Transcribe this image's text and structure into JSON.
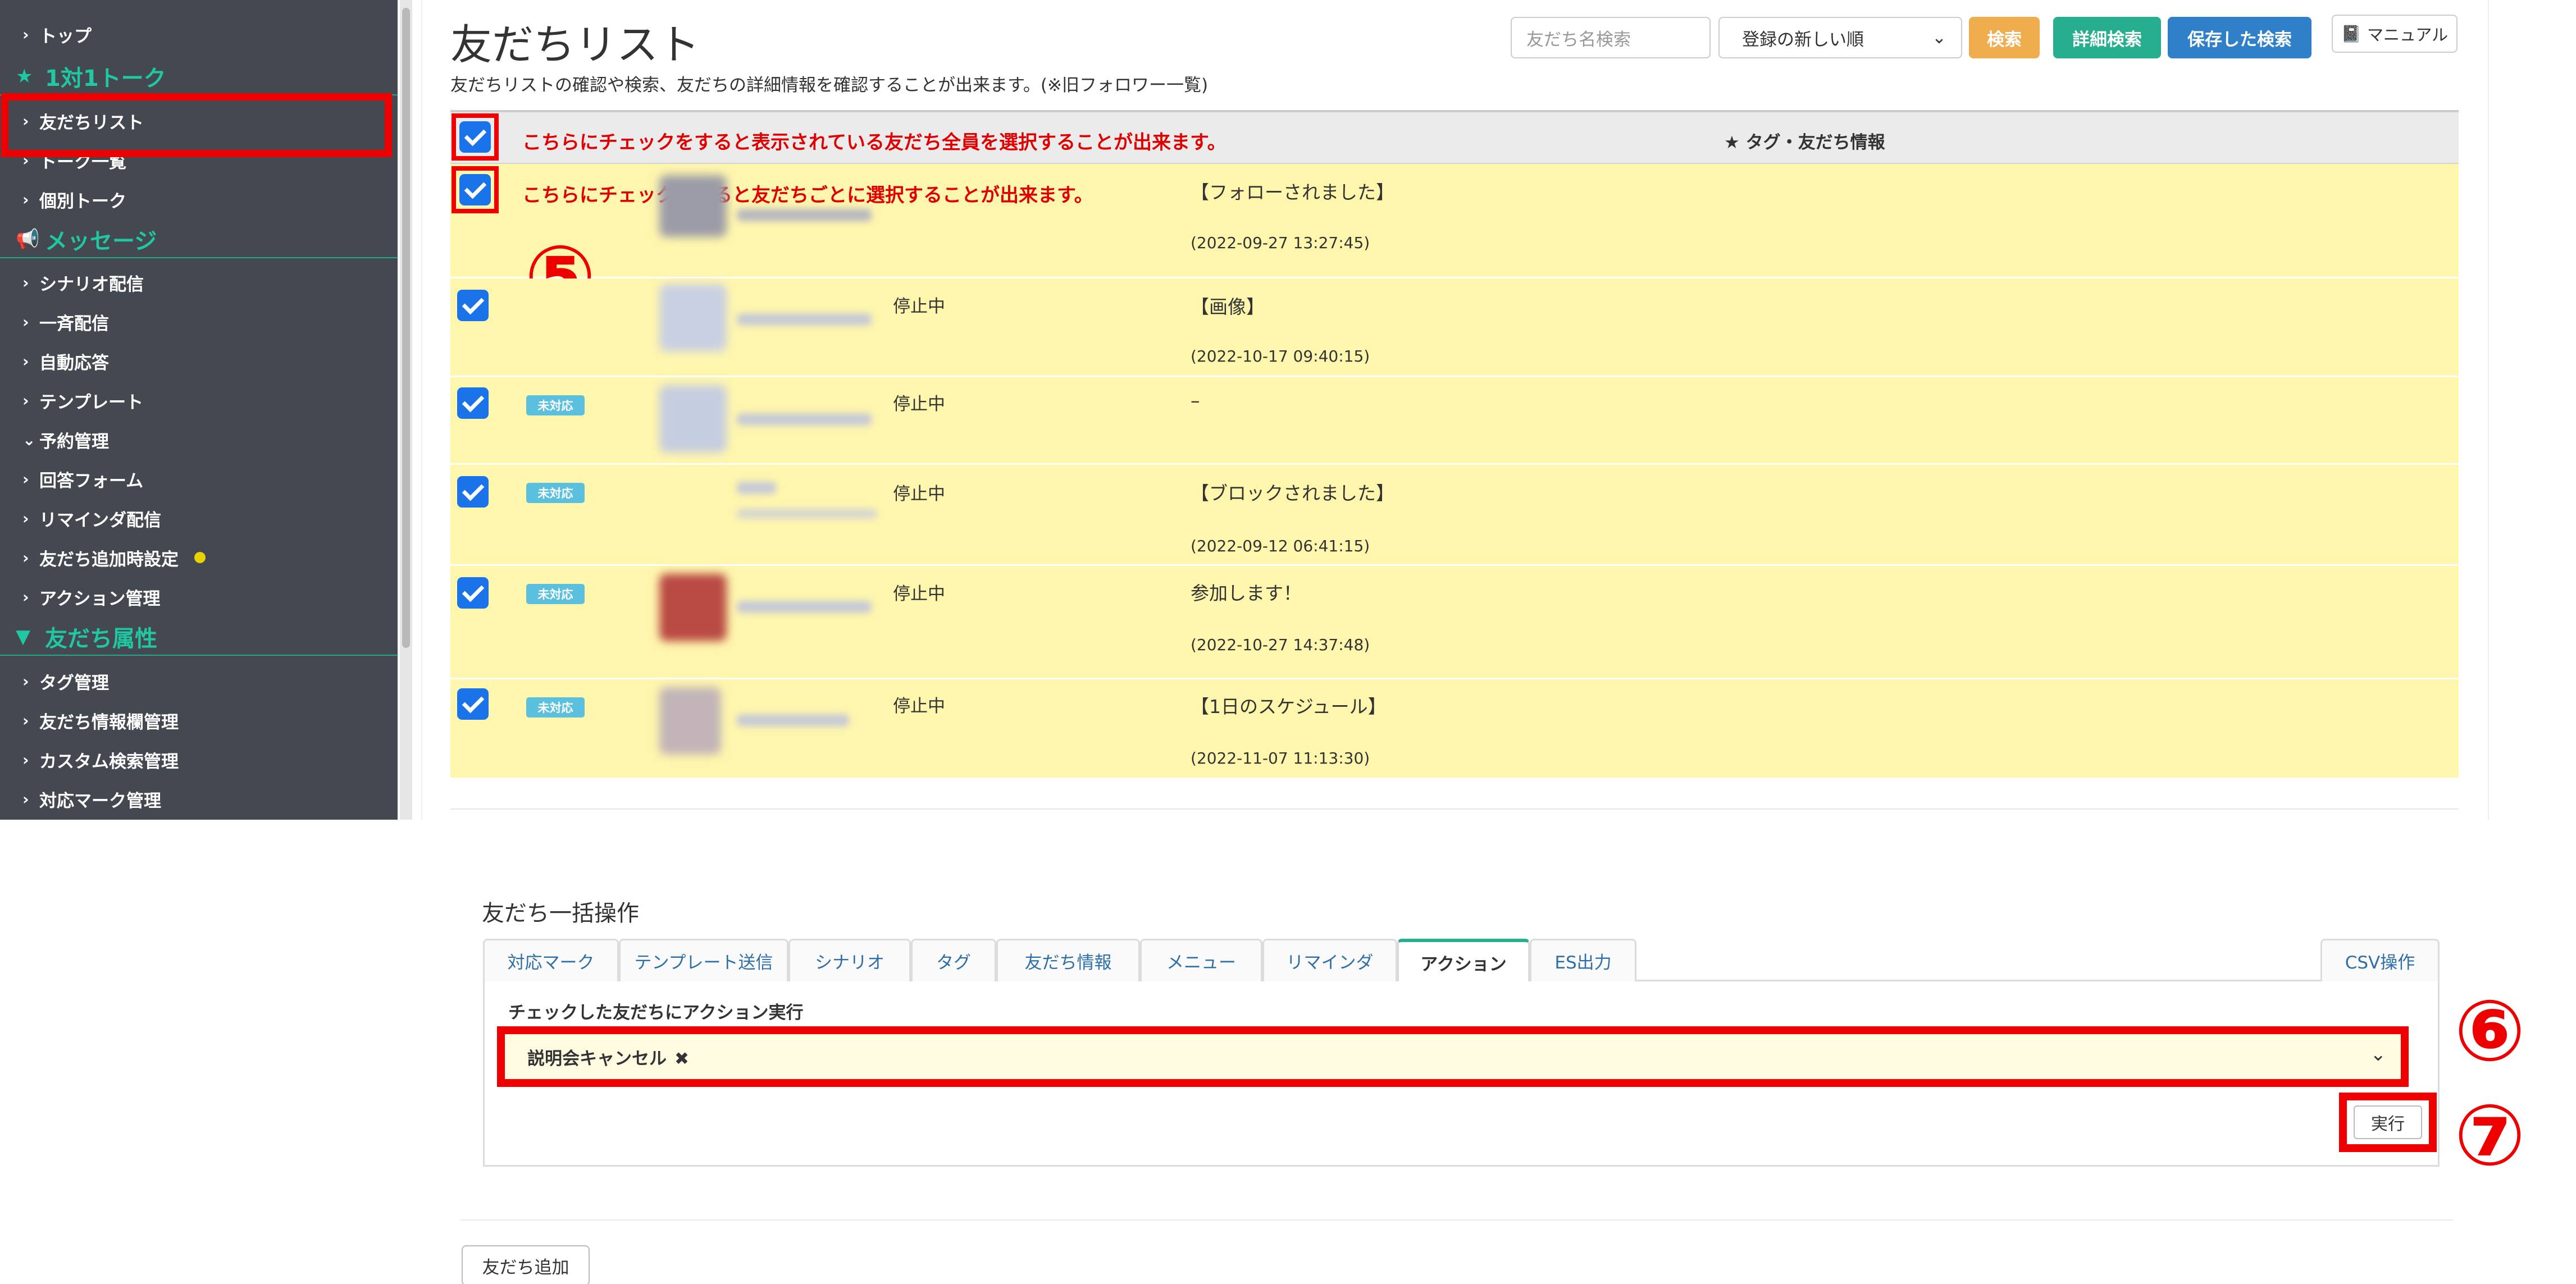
{
  "sidebar": {
    "items": [
      {
        "label": "トップ"
      },
      {
        "label": "友だちリスト"
      },
      {
        "label": "トーク一覧"
      },
      {
        "label": "個別トーク"
      },
      {
        "label": "シナリオ配信"
      },
      {
        "label": "一斉配信"
      },
      {
        "label": "自動応答"
      },
      {
        "label": "テンプレート"
      },
      {
        "label": "予約管理"
      },
      {
        "label": "回答フォーム"
      },
      {
        "label": "リマインダ配信"
      },
      {
        "label": "友だち追加時設定"
      },
      {
        "label": "アクション管理"
      },
      {
        "label": "タグ管理"
      },
      {
        "label": "友だち情報欄管理"
      },
      {
        "label": "カスタム検索管理"
      },
      {
        "label": "対応マーク管理"
      }
    ],
    "sections": [
      {
        "label": "1対1トーク"
      },
      {
        "label": "メッセージ"
      },
      {
        "label": "友だち属性"
      }
    ]
  },
  "header": {
    "title": "友だちリスト",
    "description": "友だちリストの確認や検索、友だちの詳細情報を確認することが出来ます。(※旧フォロワー一覧)",
    "search_placeholder": "友だち名検索",
    "sort_selected": "登録の新しい順",
    "search_label": "検索",
    "advanced_search_label": "詳細検索",
    "saved_search_label": "保存した検索",
    "manual_label": "マニュアル"
  },
  "table": {
    "header_note": "こちらにチェックをすると表示されている友だち全員を選択することが出来ます。",
    "column_label": "★ タグ・友だち情報",
    "rows": [
      {
        "note": "こちらにチェックをすると友だちごとに選択することが出来ます。",
        "badge": "",
        "status": "",
        "message": "【フォローされました】",
        "timestamp": "(2022-09-27 13:27:45)"
      },
      {
        "note": "",
        "badge": "",
        "status": "停止中",
        "message": "【画像】",
        "timestamp": "(2022-10-17 09:40:15)"
      },
      {
        "note": "",
        "badge": "未対応",
        "status": "停止中",
        "message": "–",
        "timestamp": ""
      },
      {
        "note": "",
        "badge": "未対応",
        "status": "停止中",
        "message": "【ブロックされました】",
        "timestamp": "(2022-09-12 06:41:15)"
      },
      {
        "note": "",
        "badge": "未対応",
        "status": "停止中",
        "message": "参加します！",
        "timestamp": "(2022-10-27 14:37:48)"
      },
      {
        "note": "",
        "badge": "未対応",
        "status": "停止中",
        "message": "【1日のスケジュール】",
        "timestamp": "(2022-11-07 11:13:30)"
      }
    ]
  },
  "annotations": {
    "step5": "⑤",
    "step6": "⑥",
    "step7": "⑦"
  },
  "bulk": {
    "title": "友だち一括操作",
    "tabs": [
      {
        "label": "対応マーク"
      },
      {
        "label": "テンプレート送信"
      },
      {
        "label": "シナリオ"
      },
      {
        "label": "タグ"
      },
      {
        "label": "友だち情報"
      },
      {
        "label": "メニュー"
      },
      {
        "label": "リマインダ"
      },
      {
        "label": "アクション"
      },
      {
        "label": "ES出力"
      },
      {
        "label": "CSV操作"
      }
    ],
    "active_tab": "アクション",
    "action_label": "チェックした友だちにアクション実行",
    "selected_action": "説明会キャンセル",
    "execute_label": "実行"
  },
  "footer": {
    "add_friend_label": "友だち追加"
  },
  "colors": {
    "sidebar_bg": "#444850",
    "accent_teal": "#1fc7a2",
    "annotation_red": "#ee0000",
    "row_highlight": "#fff6ae",
    "checkbox_blue": "#1a73e8"
  }
}
